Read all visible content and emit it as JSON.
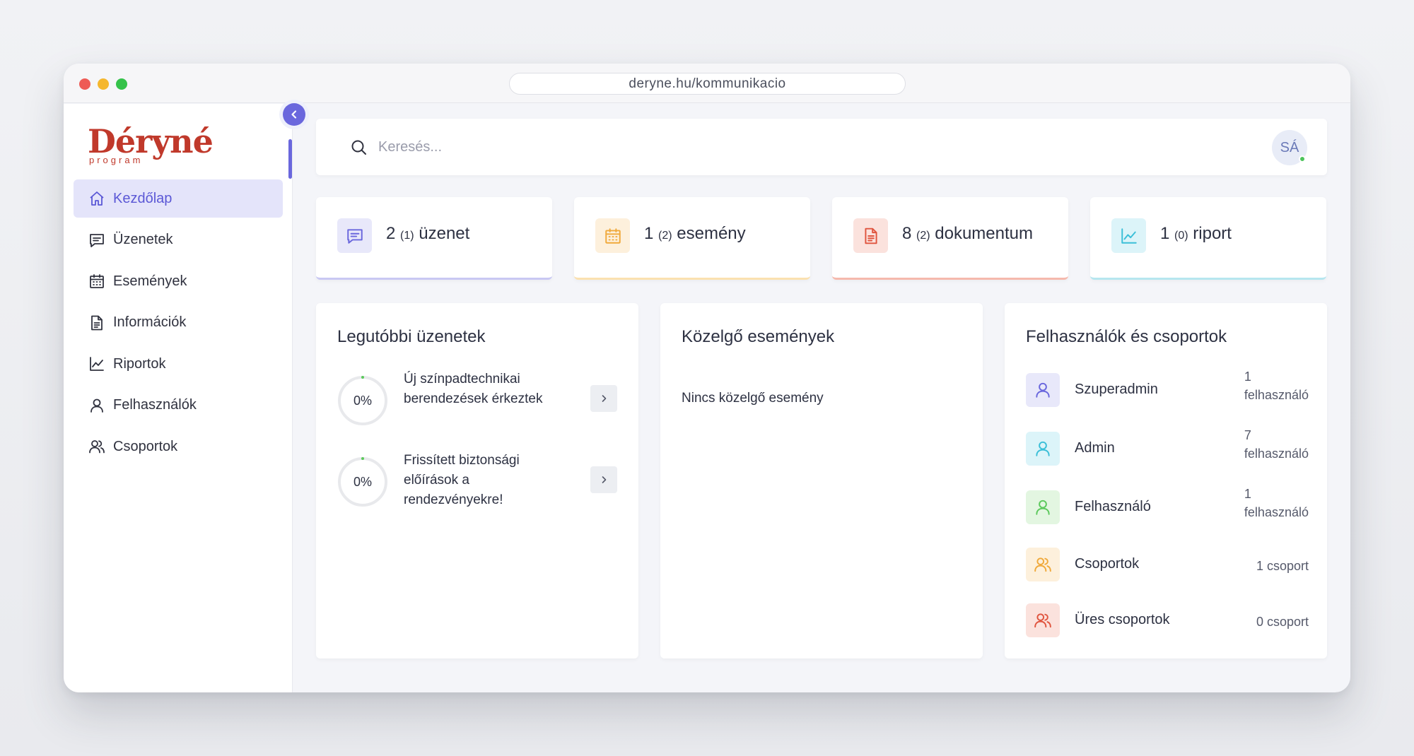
{
  "browser": {
    "url": "deryne.hu/kommunikacio"
  },
  "logo": {
    "name": "Déryné",
    "subtitle": "program"
  },
  "sidebar": {
    "items": [
      {
        "label": "Kezdőlap",
        "icon": "home-icon",
        "active": true
      },
      {
        "label": "Üzenetek",
        "icon": "message-icon",
        "active": false
      },
      {
        "label": "Események",
        "icon": "calendar-icon",
        "active": false
      },
      {
        "label": "Információk",
        "icon": "document-icon",
        "active": false
      },
      {
        "label": "Riportok",
        "icon": "chart-icon",
        "active": false
      },
      {
        "label": "Felhasználók",
        "icon": "user-icon",
        "active": false
      },
      {
        "label": "Csoportok",
        "icon": "users-icon",
        "active": false
      }
    ]
  },
  "search": {
    "placeholder": "Keresés...",
    "value": ""
  },
  "user": {
    "initials": "SÁ",
    "status_color": "#4cc35a"
  },
  "stats": [
    {
      "count": "2",
      "sub": "(1)",
      "label": "üzenet",
      "icon": "message-icon",
      "color": "#6a67dd",
      "bg": "#e8e8fa",
      "border": "#c9c8f3"
    },
    {
      "count": "1",
      "sub": "(2)",
      "label": "esemény",
      "icon": "calendar-icon",
      "color": "#f0a93b",
      "bg": "#fdf0dc",
      "border": "#fbe1b0"
    },
    {
      "count": "8",
      "sub": "(2)",
      "label": "dokumentum",
      "icon": "document-icon",
      "color": "#e0553f",
      "bg": "#fbe2dd",
      "border": "#f5b9ad"
    },
    {
      "count": "1",
      "sub": "(0)",
      "label": "riport",
      "icon": "chart-icon",
      "color": "#3bbfd8",
      "bg": "#dcf4f9",
      "border": "#b6e6ef"
    }
  ],
  "panels": {
    "messages": {
      "title": "Legutóbbi üzenetek",
      "items": [
        {
          "progress": "0%",
          "progress_value": 0,
          "text": "Új színpadtechnikai berendezések érkeztek"
        },
        {
          "progress": "0%",
          "progress_value": 0,
          "text": "Frissített biztonsági előírások a rendezvényekre!"
        }
      ]
    },
    "events": {
      "title": "Közelgő események",
      "empty": "Nincs közelgő esemény"
    },
    "users": {
      "title": "Felhasználók és csoportok",
      "items": [
        {
          "name": "Szuperadmin",
          "count_num": "1",
          "count_unit": "felhasználó",
          "icon": "user-icon",
          "color": "#6a67dd",
          "bg": "#e8e8fa"
        },
        {
          "name": "Admin",
          "count_num": "7",
          "count_unit": "felhasználó",
          "icon": "user-icon",
          "color": "#3bbfd8",
          "bg": "#dcf4f9"
        },
        {
          "name": "Felhasználó",
          "count_num": "1",
          "count_unit": "felhasználó",
          "icon": "user-icon",
          "color": "#5cc95c",
          "bg": "#e3f6e1"
        },
        {
          "name": "Csoportok",
          "count": "1 csoport",
          "icon": "users-icon",
          "color": "#f0a93b",
          "bg": "#fdf0dc"
        },
        {
          "name": "Üres csoportok",
          "count": "0 csoport",
          "icon": "users-icon",
          "color": "#e0553f",
          "bg": "#fbe2dd"
        }
      ]
    }
  }
}
